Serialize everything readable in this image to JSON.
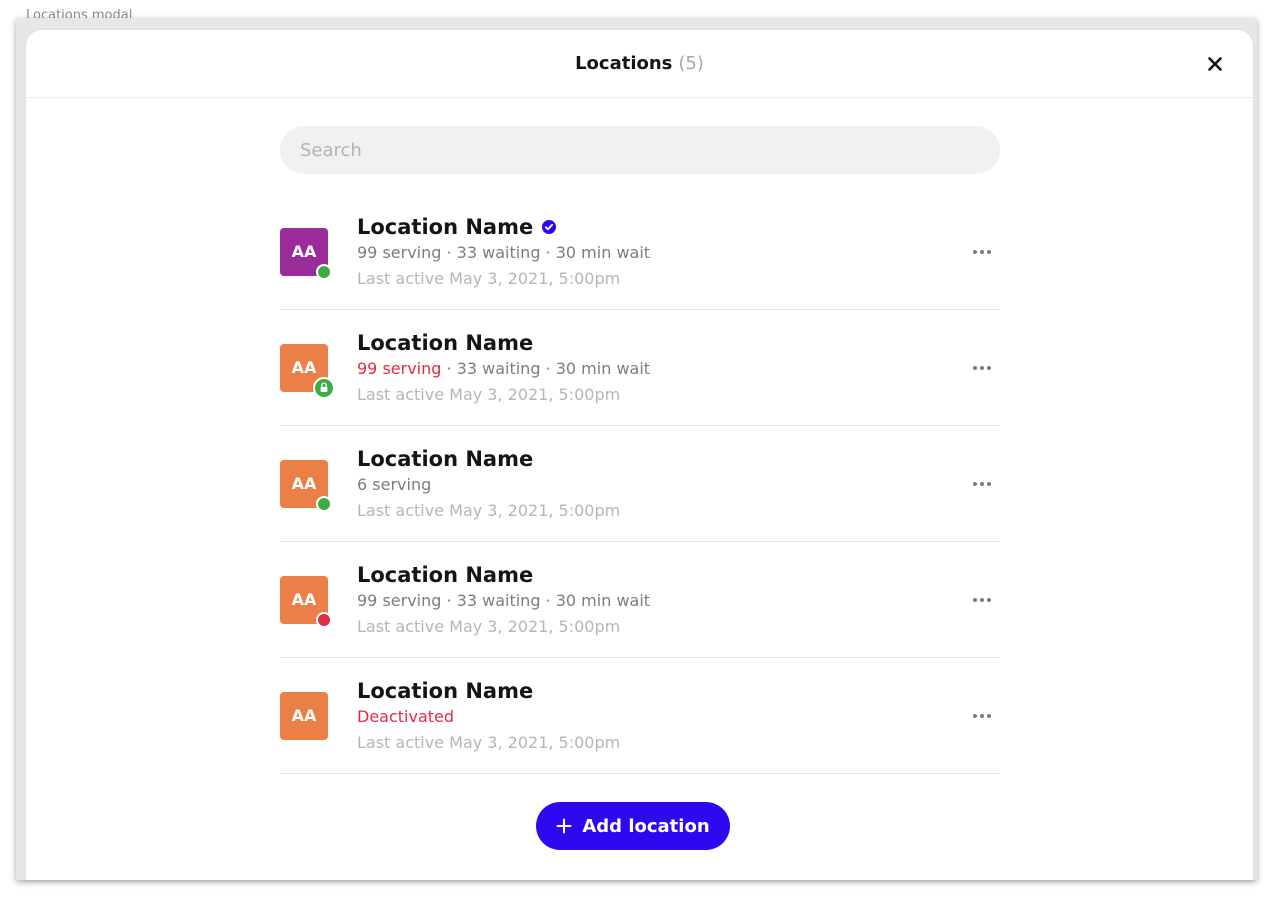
{
  "frame": {
    "label": "Locations modal"
  },
  "header": {
    "title": "Locations",
    "count": "(5)"
  },
  "search": {
    "placeholder": "Search"
  },
  "colors": {
    "accent": "#3008f0",
    "online": "#3fab47",
    "offline": "#e22b47",
    "avatar_purple": "#9b2b9a",
    "avatar_orange": "#eb7f48"
  },
  "locations": [
    {
      "initials": "AA",
      "avatar_color": "#9b2b9a",
      "name": "Location Name",
      "verified": true,
      "serving": "99 serving",
      "rest": " · 33 waiting · 30 min wait",
      "serving_alert": false,
      "last_active": "Last active May 3, 2021, 5:00pm",
      "status": "online",
      "status_icon": "status-dot"
    },
    {
      "initials": "AA",
      "avatar_color": "#eb7f48",
      "name": "Location Name",
      "verified": false,
      "serving": "99 serving",
      "rest": " · 33 waiting · 30 min wait",
      "serving_alert": true,
      "last_active": "Last active May 3, 2021, 5:00pm",
      "status": "locked",
      "status_icon": "lock-icon"
    },
    {
      "initials": "AA",
      "avatar_color": "#eb7f48",
      "name": "Location Name",
      "verified": false,
      "serving": "6 serving",
      "rest": "",
      "serving_alert": false,
      "last_active": "Last active May 3, 2021, 5:00pm",
      "status": "online",
      "status_icon": "status-dot"
    },
    {
      "initials": "AA",
      "avatar_color": "#eb7f48",
      "name": "Location Name",
      "verified": false,
      "serving": "99 serving",
      "rest": " · 33 waiting · 30 min wait",
      "serving_alert": false,
      "last_active": "Last active May 3, 2021, 5:00pm",
      "status": "offline",
      "status_icon": "status-dot"
    },
    {
      "initials": "AA",
      "avatar_color": "#eb7f48",
      "name": "Location Name",
      "verified": false,
      "serving": "Deactivated",
      "rest": "",
      "serving_alert": true,
      "last_active": "Last active May 3, 2021, 5:00pm",
      "status": "none",
      "status_icon": ""
    }
  ],
  "actions": {
    "add_label": "Add location",
    "add_icon": "plus-icon",
    "more_icon": "more-horizontal-icon",
    "close_icon": "close-icon"
  }
}
